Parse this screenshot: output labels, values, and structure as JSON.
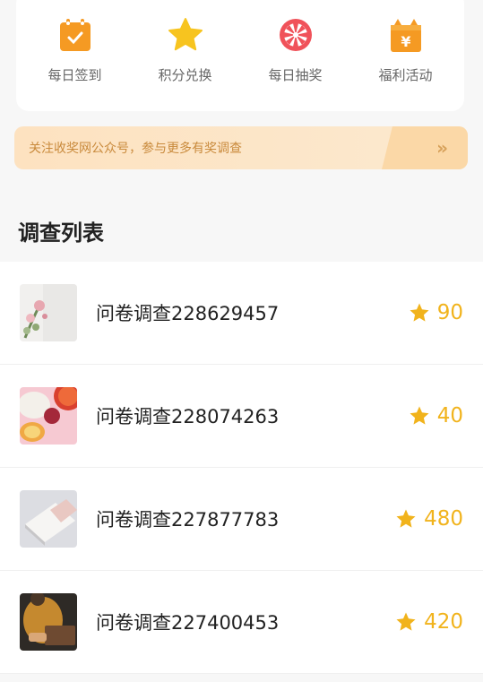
{
  "quick_menu": [
    {
      "label": "每日签到",
      "icon": "calendar-check-icon"
    },
    {
      "label": "积分兑换",
      "icon": "star-icon"
    },
    {
      "label": "每日抽奖",
      "icon": "lottery-wheel-icon"
    },
    {
      "label": "福利活动",
      "icon": "gift-yen-icon"
    }
  ],
  "banner": {
    "text": "关注收奖网公众号，参与更多有奖调查",
    "arrow": "»"
  },
  "section_title": "调查列表",
  "surveys": [
    {
      "title": "问卷调查228629457",
      "points": "90",
      "thumb": "flowers-thumbnail"
    },
    {
      "title": "问卷调查228074263",
      "points": "40",
      "thumb": "fruit-thumbnail"
    },
    {
      "title": "问卷调查227877783",
      "points": "480",
      "thumb": "notebooks-thumbnail"
    },
    {
      "title": "问卷调查227400453",
      "points": "420",
      "thumb": "person-laptop-thumbnail"
    }
  ],
  "colors": {
    "accent_orange": "#f59a23",
    "points": "#f1b31c",
    "lottery_red": "#f0525a",
    "banner_text": "#c98a3c"
  }
}
